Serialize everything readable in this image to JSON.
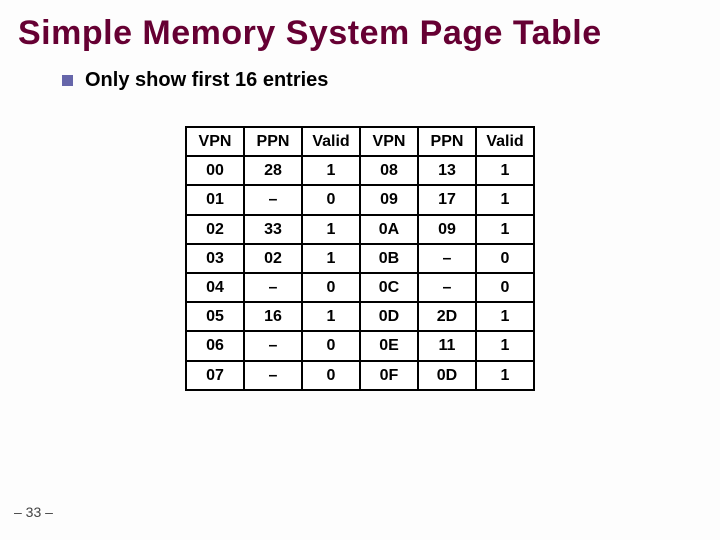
{
  "title": "Simple Memory System Page Table",
  "bullet": "Only show first 16 entries",
  "headers": [
    "VPN",
    "PPN",
    "Valid",
    "VPN",
    "PPN",
    "Valid"
  ],
  "rows": [
    [
      "00",
      "28",
      "1",
      "08",
      "13",
      "1"
    ],
    [
      "01",
      "–",
      "0",
      "09",
      "17",
      "1"
    ],
    [
      "02",
      "33",
      "1",
      "0A",
      "09",
      "1"
    ],
    [
      "03",
      "02",
      "1",
      "0B",
      "–",
      "0"
    ],
    [
      "04",
      "–",
      "0",
      "0C",
      "–",
      "0"
    ],
    [
      "05",
      "16",
      "1",
      "0D",
      "2D",
      "1"
    ],
    [
      "06",
      "–",
      "0",
      "0E",
      "11",
      "1"
    ],
    [
      "07",
      "–",
      "0",
      "0F",
      "0D",
      "1"
    ]
  ],
  "footer": "– 33 –",
  "chart_data": {
    "type": "table",
    "title": "Simple Memory System Page Table",
    "columns": [
      "VPN",
      "PPN",
      "Valid"
    ],
    "entries": [
      {
        "VPN": "00",
        "PPN": "28",
        "Valid": 1
      },
      {
        "VPN": "01",
        "PPN": null,
        "Valid": 0
      },
      {
        "VPN": "02",
        "PPN": "33",
        "Valid": 1
      },
      {
        "VPN": "03",
        "PPN": "02",
        "Valid": 1
      },
      {
        "VPN": "04",
        "PPN": null,
        "Valid": 0
      },
      {
        "VPN": "05",
        "PPN": "16",
        "Valid": 1
      },
      {
        "VPN": "06",
        "PPN": null,
        "Valid": 0
      },
      {
        "VPN": "07",
        "PPN": null,
        "Valid": 0
      },
      {
        "VPN": "08",
        "PPN": "13",
        "Valid": 1
      },
      {
        "VPN": "09",
        "PPN": "17",
        "Valid": 1
      },
      {
        "VPN": "0A",
        "PPN": "09",
        "Valid": 1
      },
      {
        "VPN": "0B",
        "PPN": null,
        "Valid": 0
      },
      {
        "VPN": "0C",
        "PPN": null,
        "Valid": 0
      },
      {
        "VPN": "0D",
        "PPN": "2D",
        "Valid": 1
      },
      {
        "VPN": "0E",
        "PPN": "11",
        "Valid": 1
      },
      {
        "VPN": "0F",
        "PPN": "0D",
        "Valid": 1
      }
    ]
  }
}
